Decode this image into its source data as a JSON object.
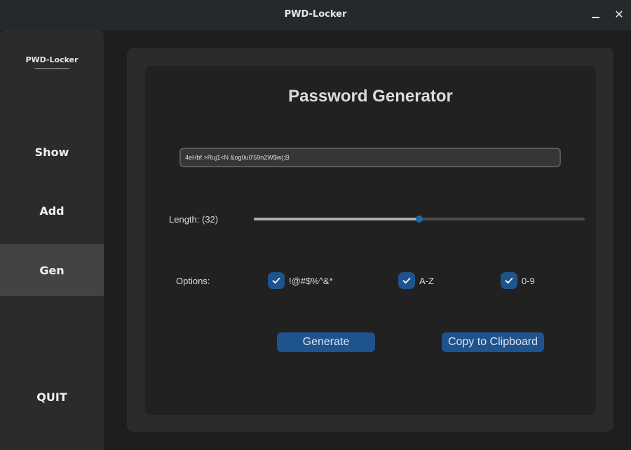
{
  "window": {
    "title": "PWD-Locker",
    "minimize_icon": "minimize-icon",
    "close_icon": "close-icon",
    "close_glyph": "✕"
  },
  "sidebar": {
    "brand": "PWD-Locker",
    "brand_rule": "------------------",
    "items": [
      {
        "label": "Show"
      },
      {
        "label": "Add"
      },
      {
        "label": "Gen",
        "active": true
      },
      {
        "label": "QUIT"
      }
    ]
  },
  "generator": {
    "heading": "Password Generator",
    "password": "4eHbf.>Ruj1<N &og0u0'59n2W$w(;B",
    "length_label": "Length: (32)",
    "length_fraction": 0.5,
    "options_label": "Options:",
    "options": [
      {
        "label": "!@#$%^&*",
        "checked": true
      },
      {
        "label": "A-Z",
        "checked": true
      },
      {
        "label": "0-9",
        "checked": true
      }
    ],
    "generate_label": "Generate",
    "copy_label": "Copy to Clipboard"
  },
  "colors": {
    "accent": "#1f538d",
    "thumb": "#1f6aa5",
    "sidebar_bg": "#2b2b2b",
    "active_nav": "#434343"
  }
}
